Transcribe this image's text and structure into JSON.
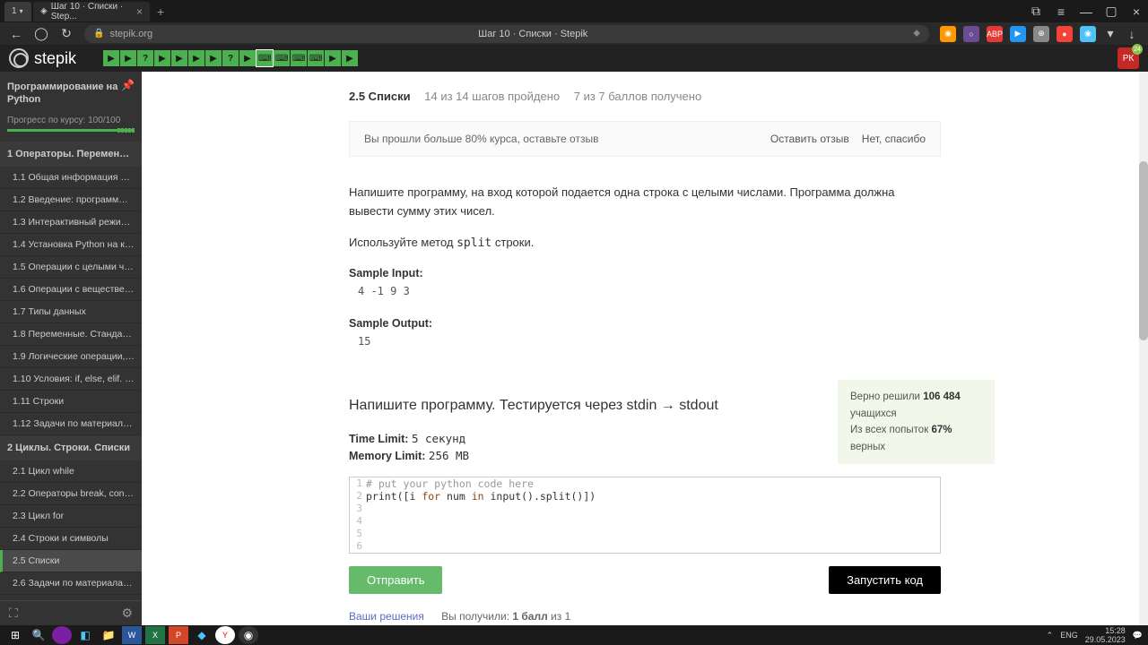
{
  "browser": {
    "tab1": "1",
    "tab_title": "Шаг 10 · Списки · Step...",
    "url_domain": "stepik.org",
    "page_title": "Шаг 10 · Списки · Stepik"
  },
  "header": {
    "logo_text": "stepik",
    "user_initials": "РК",
    "notif_count": "24"
  },
  "steps": [
    "▶",
    "▶",
    "?",
    "▶",
    "▶",
    "▶",
    "▶",
    "?",
    "▶",
    "⌨",
    "⌨",
    "⌨",
    "⌨",
    "▶",
    "▶"
  ],
  "sidebar": {
    "course_title": "Программирование на Python",
    "progress_label": "Прогресс по курсу:  100/100",
    "progress_pct": 100,
    "section1": "1  Операторы. Переменны...",
    "lessons1": [
      "1.1  Общая информация о ...",
      "1.2  Введение: программы ...",
      "1.3  Интерактивный режим...",
      "1.4  Установка Python на ко...",
      "1.5  Операции с целыми чи...",
      "1.6  Операции с веществен...",
      "1.7  Типы данных",
      "1.8  Переменные. Стандарт...",
      "1.9  Логические операции, ...",
      "1.10  Условия: if, else, elif. Б...",
      "1.11  Строки",
      "1.12  Задачи по материала..."
    ],
    "section2": "2  Циклы. Строки. Списки",
    "lessons2": [
      "2.1  Цикл while",
      "2.2  Операторы break, conti...",
      "2.3  Цикл for",
      "2.4  Строки и символы",
      "2.5  Списки",
      "2.6  Задачи по материалам..."
    ],
    "active_lesson": "2.5  Списки"
  },
  "content": {
    "breadcrumb_title": "2.5 Списки",
    "breadcrumb_progress": "14 из 14 шагов пройдено",
    "breadcrumb_score": "7 из 7 баллов  получено",
    "review_msg": "Вы прошли больше 80% курса, оставьте отзыв",
    "review_yes": "Оставить отзыв",
    "review_no": "Нет, спасибо",
    "problem_p1": "Напишите программу, на вход которой подается одна строка с целыми числами. Программа должна вывести сумму этих чисел.",
    "problem_p2_pre": "Используйте метод ",
    "problem_p2_code": "split",
    "problem_p2_post": " строки.",
    "sample_input_label": "Sample Input:",
    "sample_input": "4 -1 9 3",
    "sample_output_label": "Sample Output:",
    "sample_output": "15",
    "stats_solved_pre": "Верно решили ",
    "stats_solved_n": "106 484",
    "stats_solved_post": "учащихся",
    "stats_attempts_pre": "Из всех попыток ",
    "stats_attempts_pct": "67%",
    "stats_attempts_post": " верных",
    "task_title": "Напишите программу. Тестируется через stdin → stdout",
    "time_limit_label": "Time Limit:",
    "time_limit_val": "5 секунд",
    "mem_limit_label": "Memory Limit:",
    "mem_limit_val": "256 MB",
    "code_lines": {
      "l1": "# put your python code here",
      "l2a": "print([i",
      "l2b": " for ",
      "l2c": "num ",
      "l2d": "in ",
      "l2e": "input().split()])"
    },
    "btn_submit": "Отправить",
    "btn_run": "Запустить код",
    "solutions_link": "Ваши решения",
    "score_text_pre": "Вы получили: ",
    "score_text_b": "1 балл",
    "score_text_post": " из 1"
  },
  "taskbar": {
    "lang": "ENG",
    "time": "15:28",
    "date": "29.05.2023"
  }
}
